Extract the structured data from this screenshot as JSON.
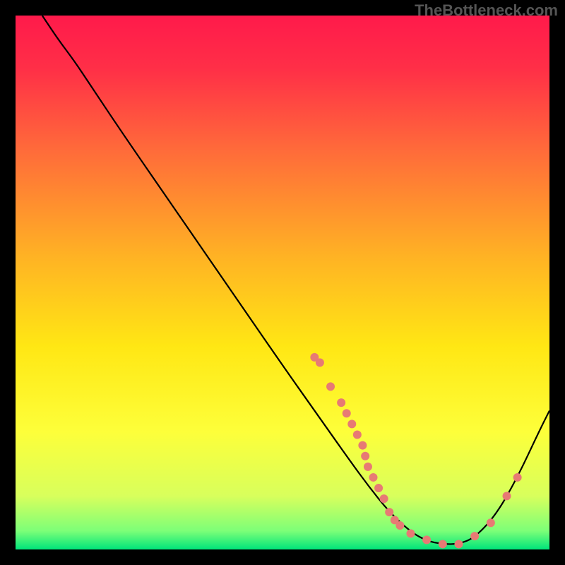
{
  "watermark": "TheBottleneck.com",
  "chart_data": {
    "type": "line",
    "title": "",
    "xlabel": "",
    "ylabel": "",
    "xlim": [
      0,
      100
    ],
    "ylim": [
      0,
      100
    ],
    "background_gradient": [
      {
        "offset": 0.0,
        "color": "#ff1a4b"
      },
      {
        "offset": 0.1,
        "color": "#ff2f47"
      },
      {
        "offset": 0.25,
        "color": "#ff6a3a"
      },
      {
        "offset": 0.45,
        "color": "#ffb224"
      },
      {
        "offset": 0.62,
        "color": "#ffe714"
      },
      {
        "offset": 0.78,
        "color": "#fdff3a"
      },
      {
        "offset": 0.9,
        "color": "#d8ff5c"
      },
      {
        "offset": 0.965,
        "color": "#7dff78"
      },
      {
        "offset": 1.0,
        "color": "#00e47a"
      }
    ],
    "curve": [
      {
        "x": 5.0,
        "y": 100.0
      },
      {
        "x": 8.0,
        "y": 95.5
      },
      {
        "x": 11.0,
        "y": 91.5
      },
      {
        "x": 14.0,
        "y": 87.0
      },
      {
        "x": 20.0,
        "y": 78.0
      },
      {
        "x": 30.0,
        "y": 63.5
      },
      {
        "x": 40.0,
        "y": 49.0
      },
      {
        "x": 50.0,
        "y": 34.5
      },
      {
        "x": 56.0,
        "y": 26.0
      },
      {
        "x": 62.0,
        "y": 17.5
      },
      {
        "x": 66.0,
        "y": 12.0
      },
      {
        "x": 70.0,
        "y": 7.0
      },
      {
        "x": 74.0,
        "y": 3.3
      },
      {
        "x": 77.0,
        "y": 1.6
      },
      {
        "x": 80.0,
        "y": 1.0
      },
      {
        "x": 83.0,
        "y": 1.0
      },
      {
        "x": 86.0,
        "y": 2.2
      },
      {
        "x": 90.0,
        "y": 6.5
      },
      {
        "x": 94.0,
        "y": 13.5
      },
      {
        "x": 98.0,
        "y": 22.0
      },
      {
        "x": 100.0,
        "y": 26.0
      }
    ],
    "points": [
      {
        "x": 56.0,
        "y": 36.0
      },
      {
        "x": 57.0,
        "y": 35.0
      },
      {
        "x": 59.0,
        "y": 30.5
      },
      {
        "x": 61.0,
        "y": 27.5
      },
      {
        "x": 62.0,
        "y": 25.5
      },
      {
        "x": 63.0,
        "y": 23.5
      },
      {
        "x": 64.0,
        "y": 21.5
      },
      {
        "x": 65.0,
        "y": 19.5
      },
      {
        "x": 65.5,
        "y": 17.5
      },
      {
        "x": 66.0,
        "y": 15.5
      },
      {
        "x": 67.0,
        "y": 13.5
      },
      {
        "x": 68.0,
        "y": 11.5
      },
      {
        "x": 69.0,
        "y": 9.5
      },
      {
        "x": 70.0,
        "y": 7.0
      },
      {
        "x": 71.0,
        "y": 5.5
      },
      {
        "x": 72.0,
        "y": 4.5
      },
      {
        "x": 74.0,
        "y": 3.0
      },
      {
        "x": 77.0,
        "y": 1.8
      },
      {
        "x": 80.0,
        "y": 1.0
      },
      {
        "x": 83.0,
        "y": 1.0
      },
      {
        "x": 86.0,
        "y": 2.5
      },
      {
        "x": 89.0,
        "y": 5.0
      },
      {
        "x": 92.0,
        "y": 10.0
      },
      {
        "x": 94.0,
        "y": 13.5
      }
    ],
    "point_color": "#e77a74",
    "point_radius": 6
  }
}
